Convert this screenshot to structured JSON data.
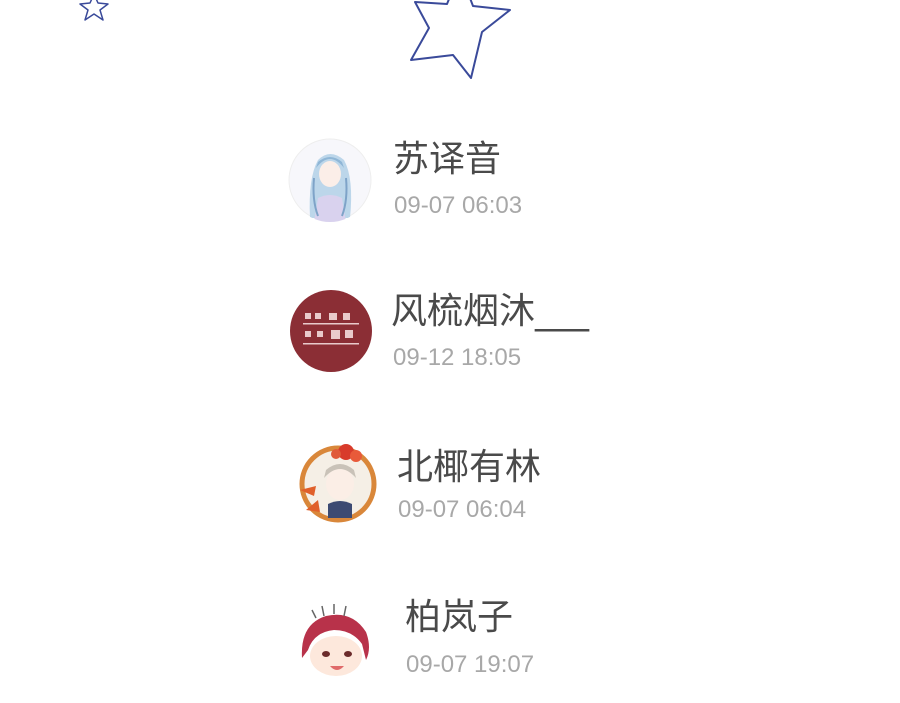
{
  "decorations": {
    "star_small_icon": "star-outline-icon",
    "star_big_icon": "star-outline-icon",
    "star_color": "#3a4a9a"
  },
  "list": {
    "items": [
      {
        "name": "苏译音",
        "time": "09-07 06:03",
        "avatar": "anime-girl-blue-hair-avatar"
      },
      {
        "name": "风梳烟沐___",
        "time": "09-12 18:05",
        "avatar": "red-calligraphy-avatar"
      },
      {
        "name": "北椰有林",
        "time": "09-07 06:04",
        "avatar": "anime-boy-flower-frame-avatar"
      },
      {
        "name": "柏岚子",
        "time": "09-07 19:07",
        "avatar": "anime-girl-red-hair-avatar"
      }
    ]
  }
}
